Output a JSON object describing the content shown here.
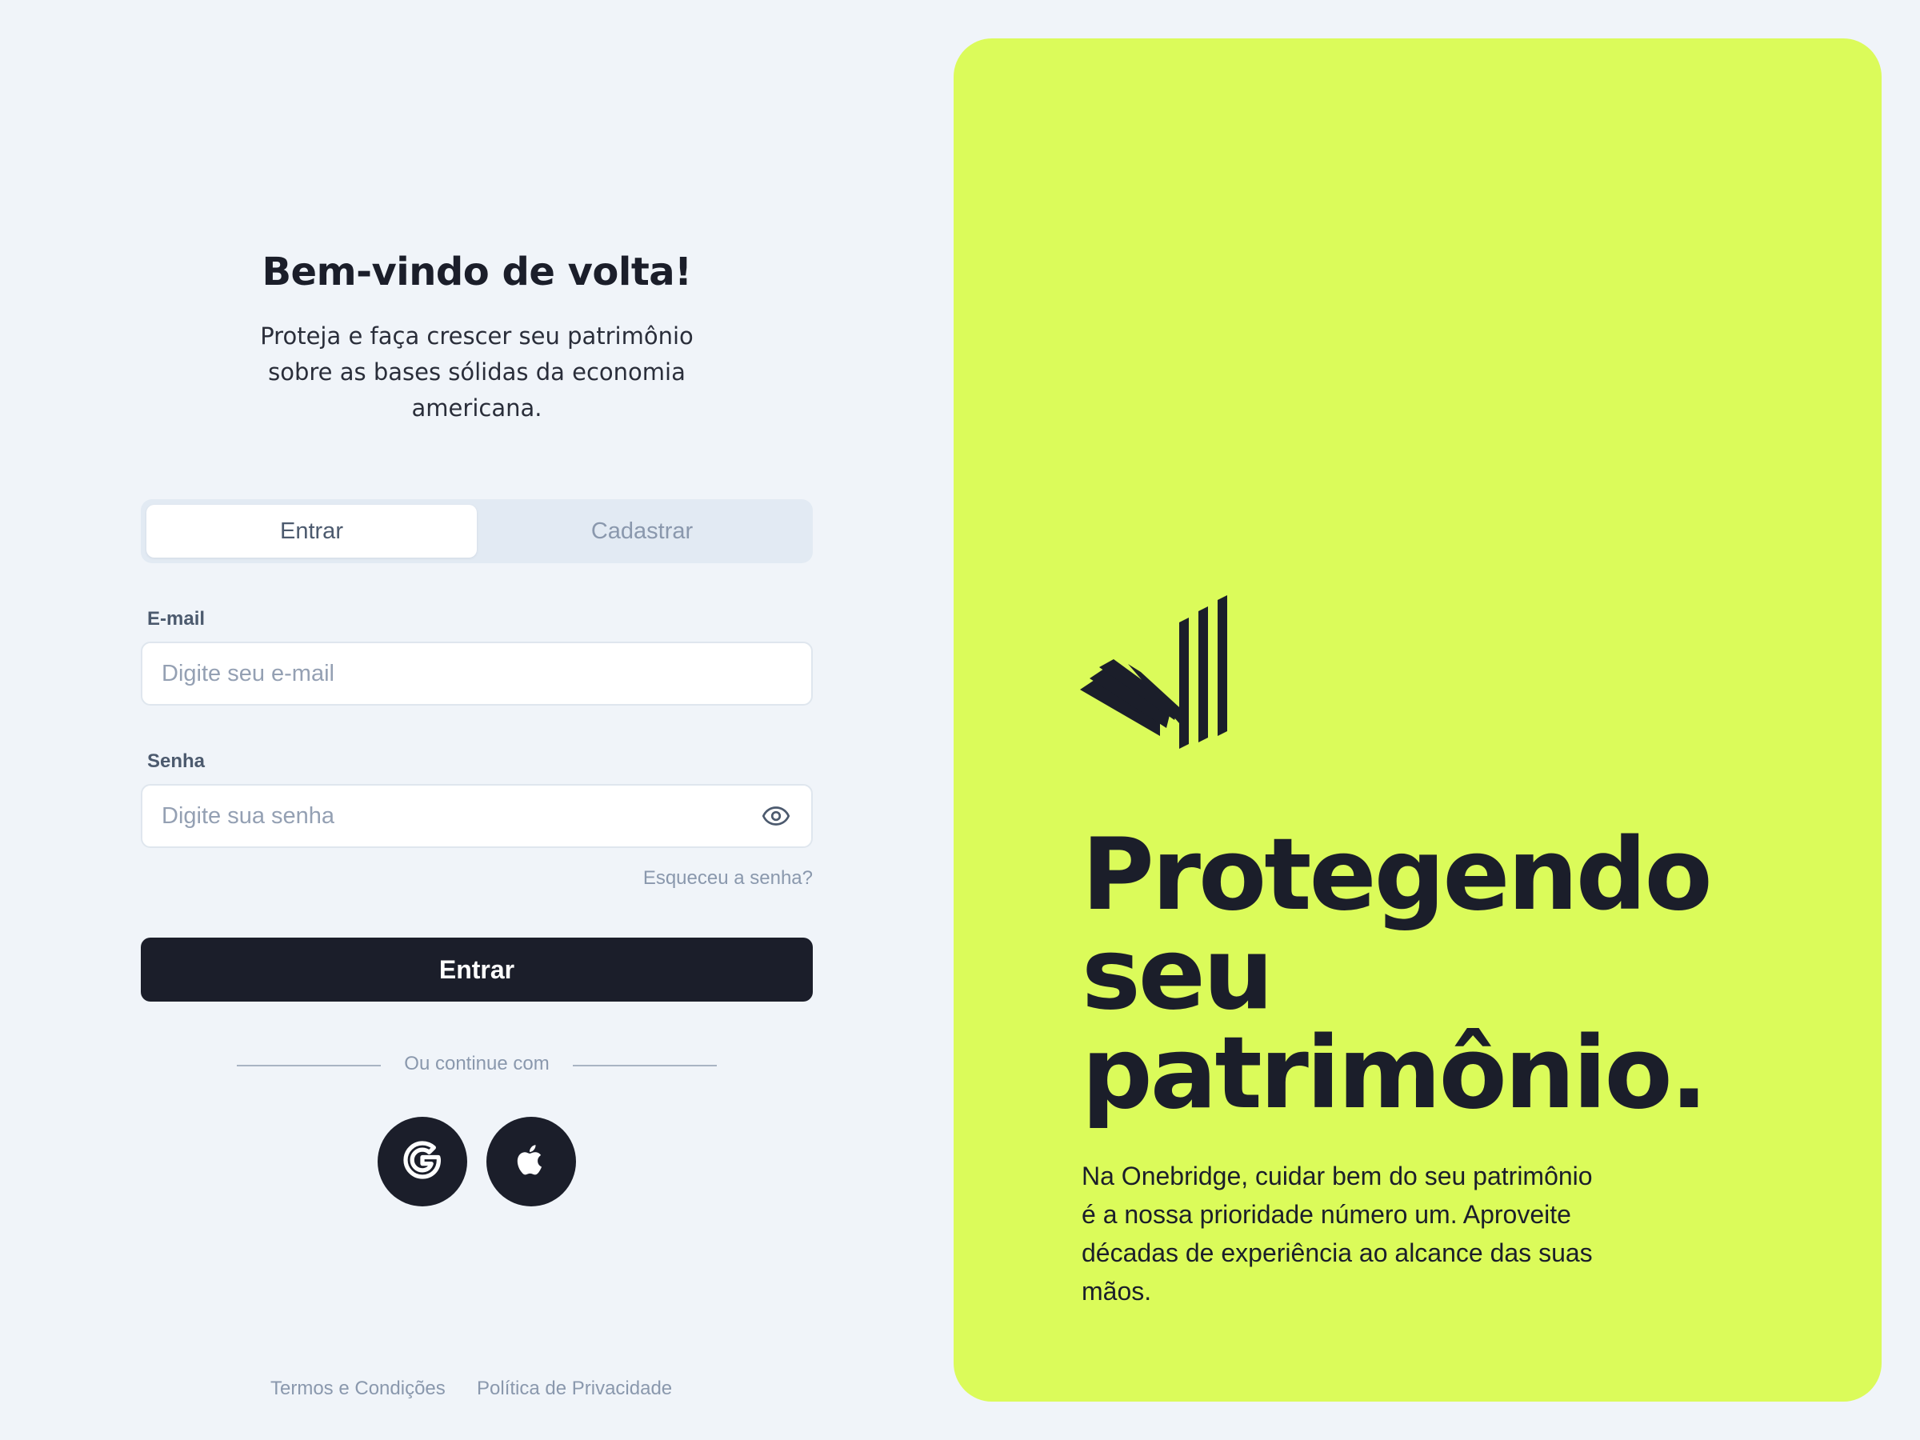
{
  "login": {
    "title": "Bem-vindo de volta!",
    "subtitle": "Proteja e faça crescer seu patrimônio sobre as bases sólidas da economia americana.",
    "tabs": [
      {
        "label": "Entrar",
        "active": true
      },
      {
        "label": "Cadastrar",
        "active": false
      }
    ],
    "email": {
      "label": "E-mail",
      "placeholder": "Digite seu e-mail",
      "value": ""
    },
    "password": {
      "label": "Senha",
      "placeholder": "Digite sua senha",
      "value": ""
    },
    "forgot_label": "Esqueceu a senha?",
    "submit_label": "Entrar",
    "divider_text": "Ou continue com",
    "social": [
      {
        "icon": "google-icon"
      },
      {
        "icon": "apple-icon"
      }
    ]
  },
  "footer": {
    "terms": "Termos e Condições",
    "privacy": "Política de Privacidade"
  },
  "hero": {
    "logo_icon": "onebridge-logo-icon",
    "headline_lines": [
      "Protegendo",
      "seu",
      "patrimônio."
    ],
    "text": "Na Onebridge, cuidar bem do seu patrimônio é a nossa prioridade número um. Aproveite décadas de experiência ao alcance das suas mãos."
  },
  "colors": {
    "background": "#f0f4f9",
    "accent": "#dbfb5a",
    "dark": "#1b1e2a",
    "muted": "#8a98ad"
  }
}
